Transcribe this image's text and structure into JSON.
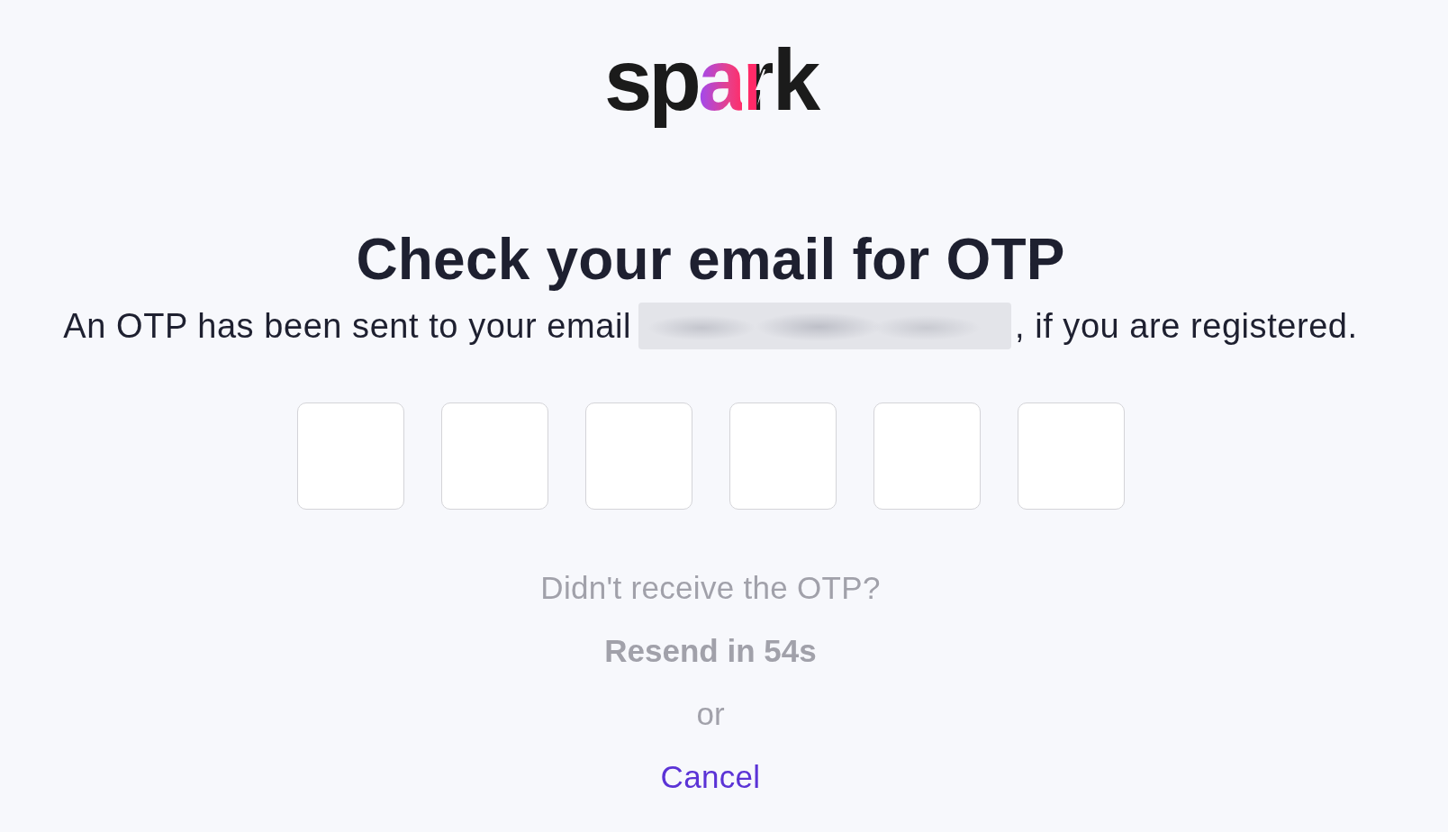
{
  "logo": {
    "parts": [
      {
        "text": "sp",
        "kind": "plain"
      },
      {
        "text": "a",
        "kind": "gradient"
      },
      {
        "text": "r",
        "kind": "bolt"
      },
      {
        "text": "k",
        "kind": "plain"
      }
    ]
  },
  "heading": "Check your email for OTP",
  "message": {
    "before": "An OTP has been sent to your email",
    "email_blurred": true,
    "after": ", if you are registered."
  },
  "otp_fields": [
    {
      "kind": "digit"
    },
    {
      "kind": "digit"
    },
    {
      "kind": "digit"
    },
    {
      "kind": "digit"
    },
    {
      "kind": "digit"
    },
    {
      "kind": "digit"
    }
  ],
  "resend": {
    "prompt": "Didn't receive the OTP?",
    "label": "Resend in 54s",
    "disabled": true
  },
  "separator": "or",
  "cancel": "Cancel"
}
